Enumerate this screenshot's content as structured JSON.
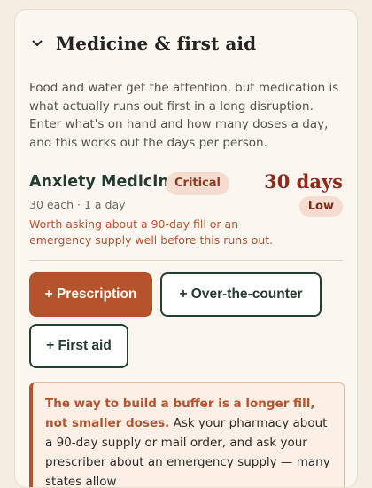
{
  "section": {
    "title": "Medicine & first aid",
    "intro": "Food and water get the attention, but medication is what actually runs out first in a long disruption. Enter what's on hand and how many doses a day, and this works out the days per person."
  },
  "medicine": {
    "name": "Anxiety Medicine",
    "priority_badge": "Critical",
    "days": "30 days",
    "status_badge": "Low",
    "dosage": "30 each · 1 a day",
    "note": "Worth asking about a 90-day fill or an emergency supply well before this runs out."
  },
  "actions": {
    "prescription": "+ Prescription",
    "otc": "+ Over-the-counter",
    "first_aid": "+ First aid"
  },
  "callout": {
    "lead": "The way to build a buffer is a longer fill, not smaller doses.",
    "body": " Ask your pharmacy about a 90-day supply or mail order, and ask your prescriber about an emergency supply — many states allow"
  },
  "colors": {
    "accent": "#b5532c",
    "critical": "#8f2a1a",
    "dark_green": "#243b30"
  },
  "icons": {
    "collapse": "chevron-down-icon"
  }
}
